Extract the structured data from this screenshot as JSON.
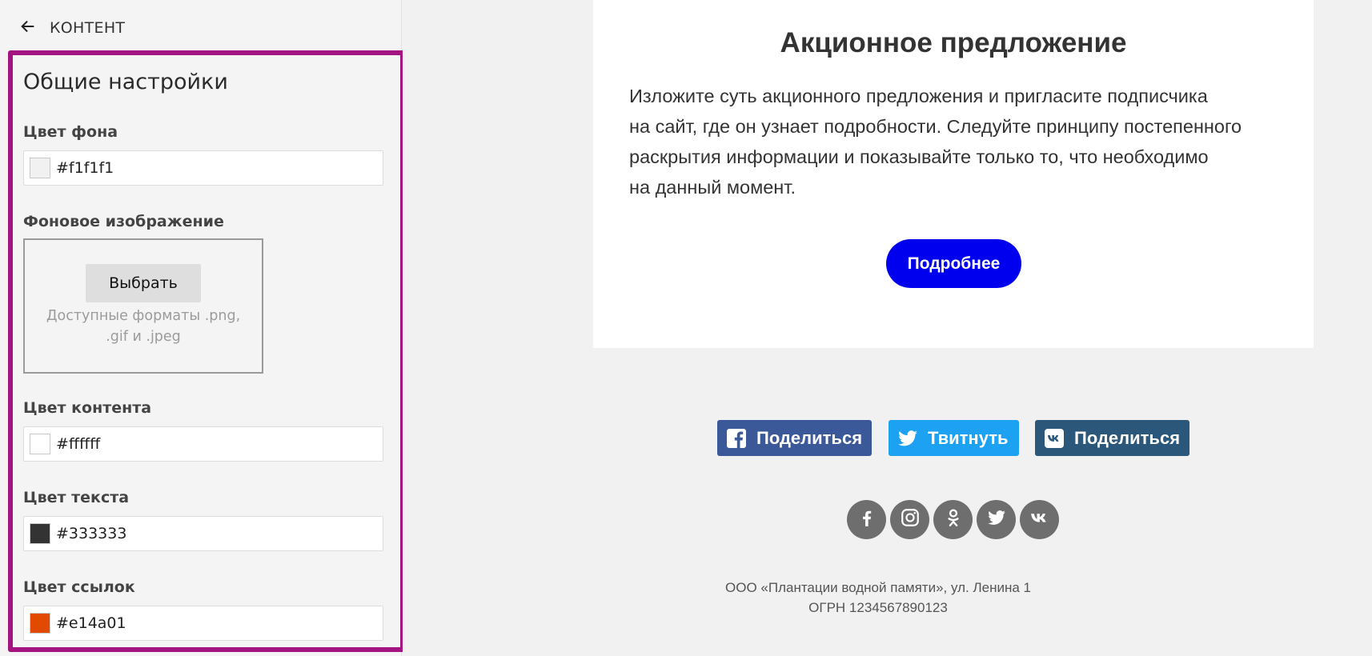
{
  "sidebar": {
    "back_label": "КОНТЕНТ",
    "section_title": "Общие настройки",
    "fields": {
      "bg_color": {
        "label": "Цвет фона",
        "value": "#f1f1f1",
        "swatch": "#f1f1f1"
      },
      "bg_image": {
        "label": "Фоновое изображение",
        "button_label": "Выбрать",
        "formats_line1": "Доступные форматы .png,",
        "formats_line2": ".gif и .jpeg"
      },
      "content_color": {
        "label": "Цвет контента",
        "value": "#ffffff",
        "swatch": "#ffffff"
      },
      "text_color": {
        "label": "Цвет текста",
        "value": "#333333",
        "swatch": "#333333"
      },
      "link_color": {
        "label": "Цвет ссылок",
        "value": "#e14a01",
        "swatch": "#e14a01"
      }
    }
  },
  "preview": {
    "title": "Акционное предложение",
    "body_lines": [
      "Изложите суть акционного предложения и пригласите подписчика",
      "на сайт, где он узнает подробности. Следуйте принципу постепенного",
      "раскрытия информации и показывайте только то, что необходимо",
      "на данный момент."
    ],
    "button_label": "Подробнее",
    "share_buttons": {
      "facebook": {
        "label": "Поделиться",
        "icon": "facebook-icon",
        "color": "#3b5998"
      },
      "twitter": {
        "label": "Твитнуть",
        "icon": "twitter-icon",
        "color": "#1da1f2"
      },
      "vk": {
        "label": "Поделиться",
        "icon": "vk-icon",
        "color": "#2a577a"
      }
    },
    "social_icons": [
      "facebook-icon",
      "instagram-icon",
      "odnoklassniki-icon",
      "twitter-icon",
      "vk-icon"
    ],
    "footer": {
      "line1": "ООО «Плантации водной памяти», ул. Ленина 1",
      "line2": "ОГРН 1234567890123"
    }
  },
  "colors": {
    "accent_frame": "#a31480",
    "cta_button": "#0000ee",
    "social_circle": "#6e6e6e"
  }
}
